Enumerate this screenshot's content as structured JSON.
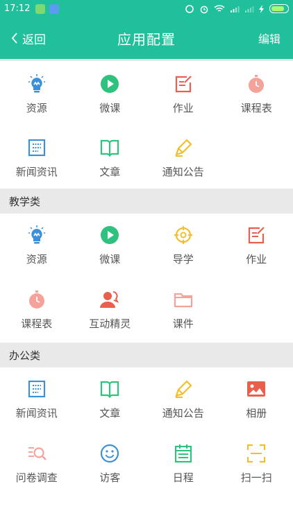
{
  "status_bar": {
    "time": "17:12"
  },
  "nav": {
    "back_label": "返回",
    "title": "应用配置",
    "edit_label": "编辑"
  },
  "colors": {
    "primary": "#20c09c",
    "blue": "#3d8fd6",
    "green": "#2ec27e",
    "red": "#e8604c",
    "pink": "#f4a29a",
    "yellow": "#f2bf2a"
  },
  "my_apps": [
    {
      "label": "资源",
      "icon": "lightbulb-icon"
    },
    {
      "label": "微课",
      "icon": "play-circle-icon"
    },
    {
      "label": "作业",
      "icon": "edit-note-icon"
    },
    {
      "label": "课程表",
      "icon": "stopwatch-icon"
    },
    {
      "label": "新闻资讯",
      "icon": "newspaper-icon"
    },
    {
      "label": "文章",
      "icon": "book-icon"
    },
    {
      "label": "通知公告",
      "icon": "pencil-icon"
    }
  ],
  "sections": [
    {
      "title": "教学类",
      "items": [
        {
          "label": "资源",
          "icon": "lightbulb-icon"
        },
        {
          "label": "微课",
          "icon": "play-circle-icon"
        },
        {
          "label": "导学",
          "icon": "target-icon"
        },
        {
          "label": "作业",
          "icon": "edit-note-icon"
        },
        {
          "label": "课程表",
          "icon": "stopwatch-icon"
        },
        {
          "label": "互动精灵",
          "icon": "user-chat-icon"
        },
        {
          "label": "课件",
          "icon": "folder-icon"
        }
      ]
    },
    {
      "title": "办公类",
      "items": [
        {
          "label": "新闻资讯",
          "icon": "newspaper-icon"
        },
        {
          "label": "文章",
          "icon": "book-icon"
        },
        {
          "label": "通知公告",
          "icon": "pencil-icon"
        },
        {
          "label": "相册",
          "icon": "photo-icon"
        },
        {
          "label": "问卷调查",
          "icon": "survey-search-icon"
        },
        {
          "label": "访客",
          "icon": "smiley-icon"
        },
        {
          "label": "日程",
          "icon": "calendar-icon"
        },
        {
          "label": "扫一扫",
          "icon": "scan-icon"
        }
      ]
    }
  ]
}
